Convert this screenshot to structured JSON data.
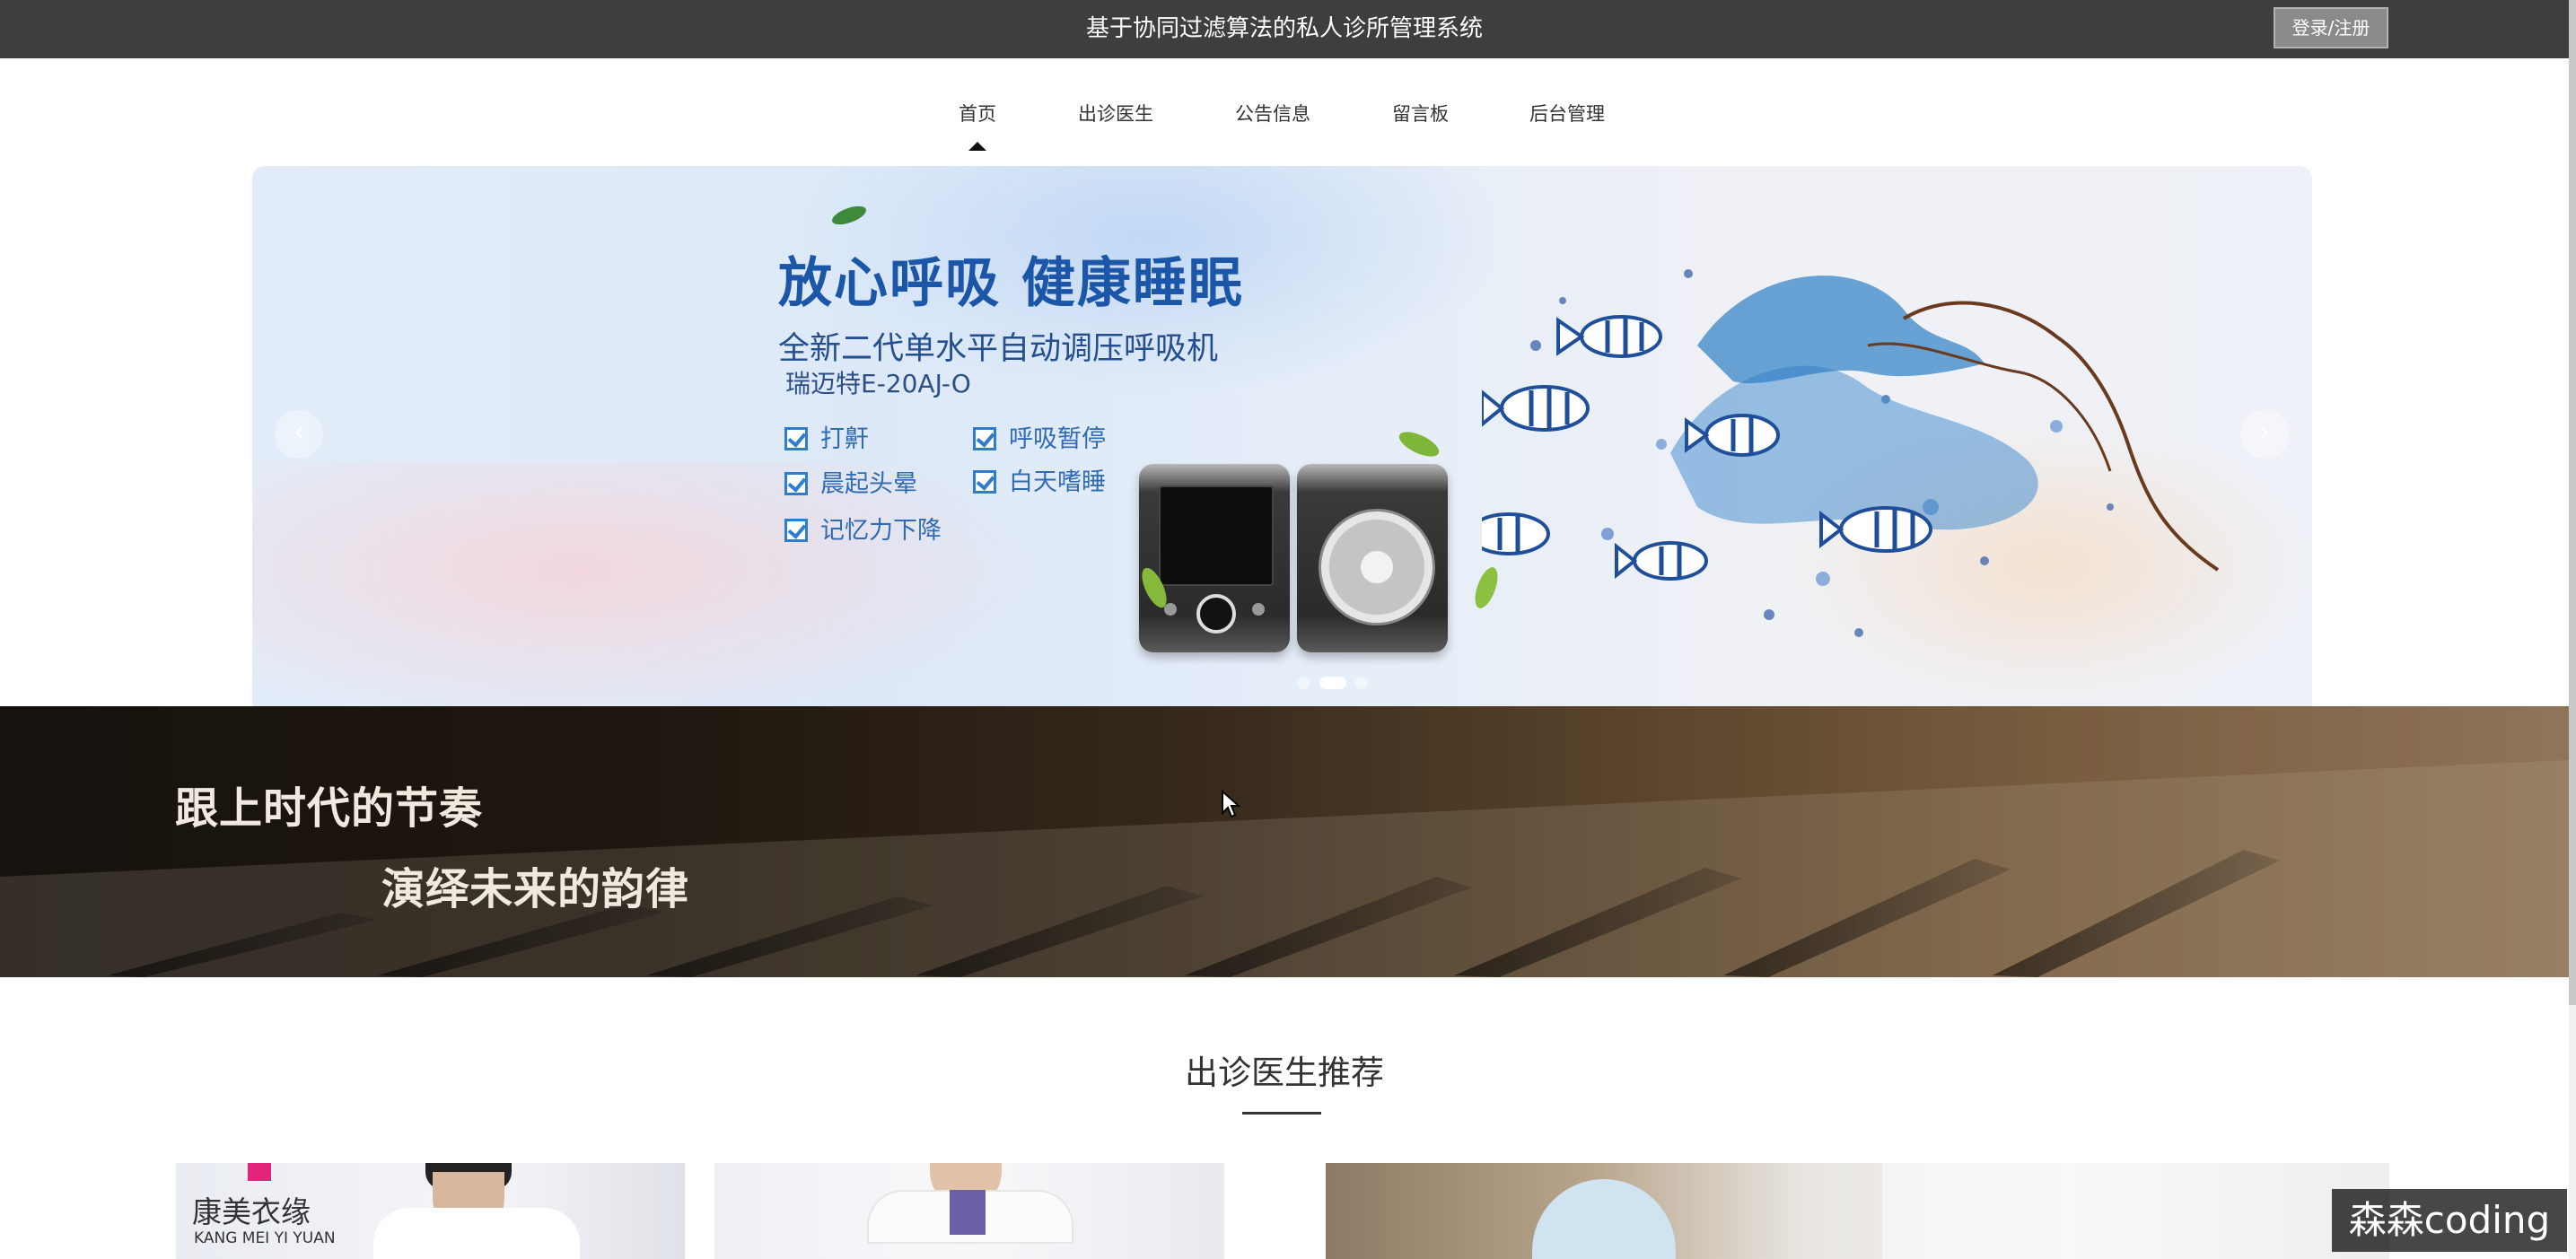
{
  "header": {
    "title": "基于协同过滤算法的私人诊所管理系统",
    "login_label": "登录/注册"
  },
  "nav": {
    "items": [
      {
        "label": "首页",
        "active": true
      },
      {
        "label": "出诊医生",
        "active": false
      },
      {
        "label": "公告信息",
        "active": false
      },
      {
        "label": "留言板",
        "active": false
      },
      {
        "label": "后台管理",
        "active": false
      }
    ]
  },
  "carousel": {
    "headline": "放心呼吸 健康睡眠",
    "subtitle": "全新二代单水平自动调压呼吸机",
    "model": "瑞迈特E-20AJ-O",
    "checks": [
      "打鼾",
      "呼吸暂停",
      "晨起头晕",
      "白天嗜睡",
      "记忆力下降"
    ],
    "prev_icon": "chevron-left-icon",
    "next_icon": "chevron-right-icon",
    "slide_count": 3,
    "active_slide": 2
  },
  "banner": {
    "line1": "跟上时代的节奏",
    "line2": "演绎未来的韵律"
  },
  "doctors_section": {
    "title": "出诊医生推荐",
    "card1_brand_cn": "康美衣缘",
    "card1_brand_en": "KANG MEI YI YUAN"
  },
  "watermark": "森森coding",
  "colors": {
    "topbar": "#3e3e3e",
    "headline_blue": "#1b56a8",
    "check_blue": "#2f7dd1"
  }
}
